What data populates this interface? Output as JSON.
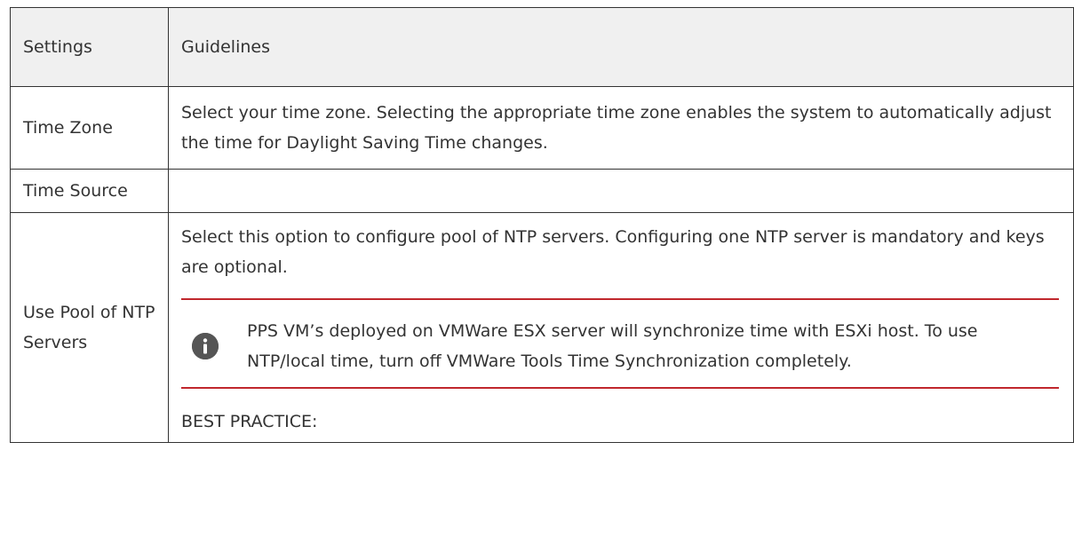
{
  "table": {
    "headers": {
      "settings": "Settings",
      "guidelines": "Guidelines"
    },
    "rows": [
      {
        "setting": "Time Zone",
        "guideline": "Select your time zone. Selecting the appropriate time zone enables the system to automatically adjust the time for Daylight Saving Time changes."
      },
      {
        "setting": "Time Source",
        "guideline": ""
      },
      {
        "setting": "Use Pool of NTP Servers",
        "guideline": "Select this option to configure pool of NTP servers. Configuring one NTP server is mandatory and keys are optional.",
        "note": {
          "icon": "info-icon",
          "text": "PPS VM’s deployed on VMWare ESX server will synchronize time with ESXi host. To use NTP/local time, turn off VMWare Tools Time Synchronization completely."
        },
        "best_practice_label": "BEST PRACTICE:"
      }
    ]
  },
  "colors": {
    "border": "#333333",
    "header_bg": "#f0f0f0",
    "note_rule": "#c0272d",
    "icon_bg": "#555555"
  }
}
